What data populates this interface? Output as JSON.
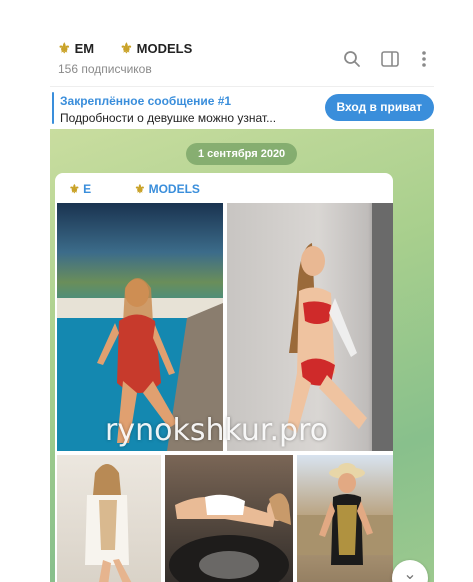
{
  "channel": {
    "title_part1": "EM",
    "title_part2": "MODELS",
    "subscribers": "156 подписчиков"
  },
  "header_icons": [
    "search-icon",
    "sidebar-toggle-icon",
    "more-vert-icon"
  ],
  "pinned": {
    "title": "Закреплённое сообщение #1",
    "text": "Подробности о девушке можно узнат...",
    "button_label": "Вход в приват"
  },
  "chat": {
    "date": "1 сентября 2020",
    "message": {
      "sender_part1": "E",
      "sender_part2": "MODELS",
      "photo_count": 5
    }
  },
  "watermark": "rynokshkur.pro",
  "colors": {
    "accent": "#3a8edb",
    "chat_bg": "#a8cf8d",
    "fleur": "#c9a227"
  }
}
